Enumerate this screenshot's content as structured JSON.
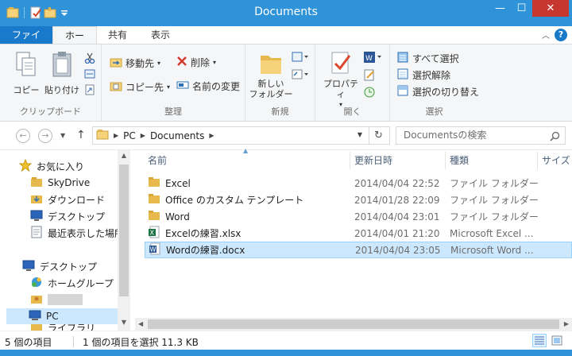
{
  "window": {
    "title": "Documents"
  },
  "titlebar": {
    "minimize": "—",
    "maximize": "☐",
    "close": "✕"
  },
  "ribbon_tabs": {
    "file": "ファイル",
    "home": "ホーム",
    "share": "共有",
    "view": "表示"
  },
  "ribbon": {
    "clipboard": {
      "label": "クリップボード",
      "copy": "コピー",
      "paste": "貼り付け"
    },
    "organize": {
      "label": "整理",
      "move_to": "移動先",
      "copy_to": "コピー先",
      "delete": "削除",
      "rename": "名前の変更"
    },
    "new": {
      "label": "新規",
      "new_folder_1": "新しい",
      "new_folder_2": "フォルダー"
    },
    "open": {
      "label": "開く",
      "properties": "プロパティ"
    },
    "select": {
      "label": "選択",
      "select_all": "すべて選択",
      "select_none": "選択解除",
      "invert": "選択の切り替え"
    }
  },
  "address": {
    "segments": [
      "PC",
      "Documents"
    ]
  },
  "search": {
    "placeholder": "Documentsの検索"
  },
  "navigation": {
    "items": [
      {
        "label": "お気に入り",
        "icon": "star-icon"
      },
      {
        "label": "SkyDrive",
        "icon": "folder-icon"
      },
      {
        "label": "ダウンロード",
        "icon": "download-folder-icon"
      },
      {
        "label": "デスクトップ",
        "icon": "desktop-icon"
      },
      {
        "label": "最近表示した場所",
        "icon": "recent-places-icon"
      },
      {
        "label": "デスクトップ",
        "icon": "desktop-icon"
      },
      {
        "label": "ホームグループ",
        "icon": "homegroup-icon"
      },
      {
        "label": "",
        "icon": "user-folder-icon"
      },
      {
        "label": "PC",
        "icon": "pc-icon"
      },
      {
        "label": "ライブラリ",
        "icon": "library-icon"
      }
    ]
  },
  "columns": {
    "name": "名前",
    "modified": "更新日時",
    "type": "種類",
    "size": "サイズ"
  },
  "files": [
    {
      "name": "Excel",
      "modified": "2014/04/04 22:52",
      "type": "ファイル フォルダー",
      "icon": "folder-icon"
    },
    {
      "name": "Office のカスタム テンプレート",
      "modified": "2014/01/28 22:09",
      "type": "ファイル フォルダー",
      "icon": "folder-icon"
    },
    {
      "name": "Word",
      "modified": "2014/04/04 23:01",
      "type": "ファイル フォルダー",
      "icon": "folder-icon"
    },
    {
      "name": "Excelの練習.xlsx",
      "modified": "2014/04/01 21:20",
      "type": "Microsoft Excel ...",
      "icon": "excel-file-icon"
    },
    {
      "name": "Wordの練習.docx",
      "modified": "2014/04/04 23:05",
      "type": "Microsoft Word ...",
      "icon": "word-file-icon",
      "selected": true
    }
  ],
  "status": {
    "count": "5 個の項目",
    "selection": "1 個の項目を選択  11.3 KB"
  },
  "colors": {
    "accent": "#2e93d8",
    "file_tab": "#1979ca",
    "selection": "#cce8ff",
    "close": "#c7372f"
  }
}
